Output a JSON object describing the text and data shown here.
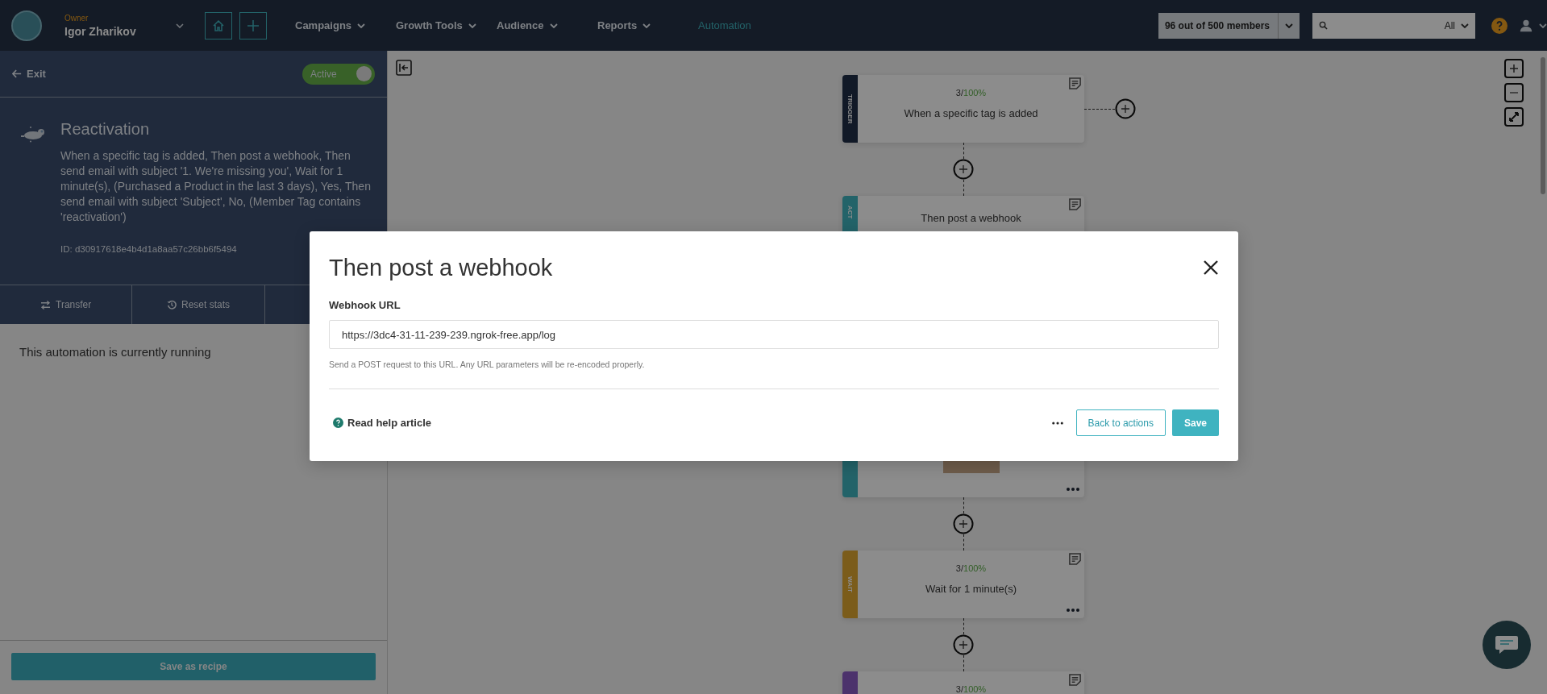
{
  "nav": {
    "role": "Owner",
    "user": "Igor Zharikov",
    "menu": [
      {
        "label": "Campaigns",
        "dropdown": true,
        "selected": false
      },
      {
        "label": "Growth Tools",
        "dropdown": true,
        "selected": false
      },
      {
        "label": "Audience",
        "dropdown": true,
        "selected": false
      },
      {
        "label": "Reports",
        "dropdown": true,
        "selected": false
      },
      {
        "label": "Automation",
        "dropdown": false,
        "selected": true
      }
    ],
    "members": "96 out of 500 members",
    "search_scope": "All"
  },
  "sidebar": {
    "exit": "Exit",
    "status": {
      "label": "Active",
      "on": true
    },
    "title": "Reactivation",
    "description": "When a specific tag is added, Then post a webhook, Then send email with subject '1. We're missing you', Wait for 1 minute(s), (Purchased a Product in the last 3 days), Yes, Then send email with subject 'Subject', No, (Member Tag contains 'reactivation')",
    "id": "ID: d30917618e4b4d1a8aa57c26bb6f5494",
    "actions": [
      {
        "label": "Transfer"
      },
      {
        "label": "Reset stats"
      }
    ],
    "status_text": "This automation is currently running",
    "save_button": "Save as recipe"
  },
  "flow": {
    "steps": [
      {
        "kind": "trigger",
        "label": "TRIGGER",
        "color": "#111927",
        "count": "3/",
        "rate": "100%",
        "text": "When a specific tag is added",
        "branch": true
      },
      {
        "kind": "action",
        "label": "ACT",
        "color": "#236369",
        "text": "Then post a webhook",
        "branch": false
      },
      {
        "kind": "email",
        "color": "#236369",
        "branch": false
      },
      {
        "kind": "wait",
        "label": "WAIT",
        "color": "#7b5c1a",
        "count": "3/",
        "rate": "100%",
        "text": "Wait for 1 minute(s)",
        "branch": false
      },
      {
        "kind": "condition",
        "color": "#4c326c",
        "count": "3/",
        "rate": "100%",
        "branch": false
      }
    ]
  },
  "modal": {
    "title": "Then post a webhook",
    "field_label": "Webhook URL",
    "url": "https://3dc4-31-11-239-239.ngrok-free.app/log",
    "hint": "Send a POST request to this URL. Any URL parameters will be re-encoded properly.",
    "help_link": "Read help article",
    "back_button": "Back to actions",
    "save_button": "Save"
  }
}
